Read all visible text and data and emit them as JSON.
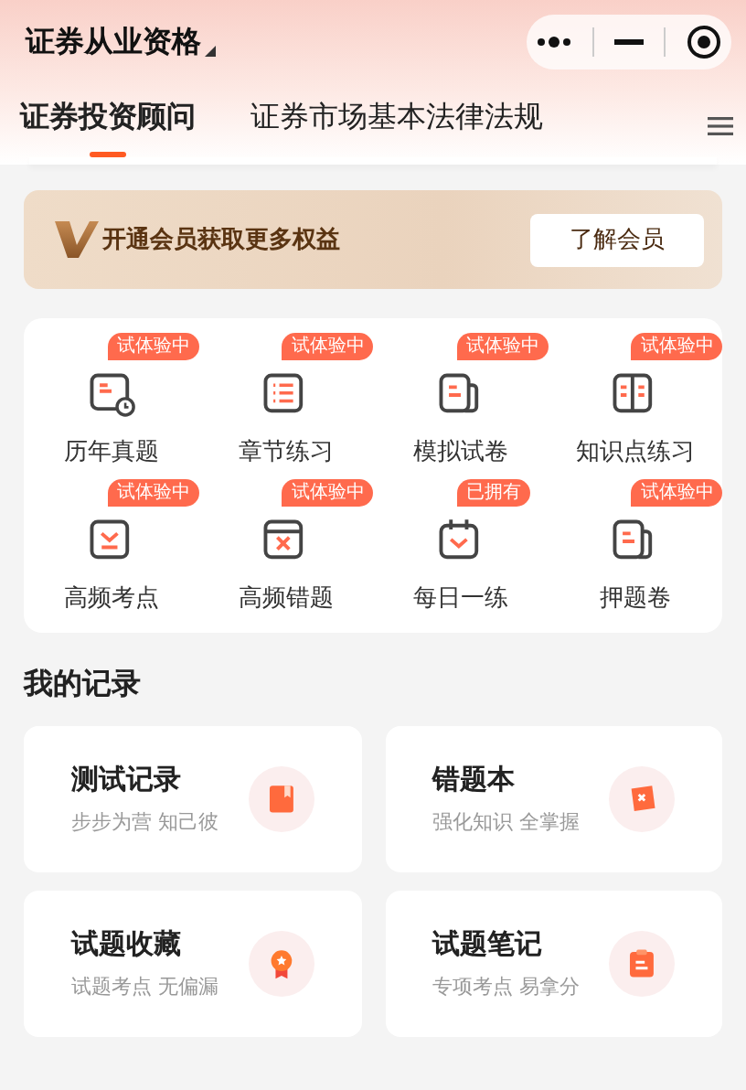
{
  "header": {
    "title": "证券从业资格"
  },
  "tabs": [
    {
      "label": "证券投资顾问",
      "selected": true
    },
    {
      "label": "证券市场基本法律法规",
      "selected": false
    }
  ],
  "banner": {
    "text": "开通会员获取更多权益",
    "button": "了解会员"
  },
  "features": [
    {
      "label": "历年真题",
      "badge": "试体验中",
      "kind": "history"
    },
    {
      "label": "章节练习",
      "badge": "试体验中",
      "kind": "list"
    },
    {
      "label": "模拟试卷",
      "badge": "试体验中",
      "kind": "paper"
    },
    {
      "label": "知识点练习",
      "badge": "试体验中",
      "kind": "book"
    },
    {
      "label": "高频考点",
      "badge": "试体验中",
      "kind": "point"
    },
    {
      "label": "高频错题",
      "badge": "试体验中",
      "kind": "wrong"
    },
    {
      "label": "每日一练",
      "badge": "已拥有",
      "kind": "calendar"
    },
    {
      "label": "押题卷",
      "badge": "试体验中",
      "kind": "paper"
    }
  ],
  "records": {
    "title": "我的记录",
    "cards": [
      {
        "title": "测试记录",
        "subtitle": "步步为营 知己彼",
        "kind": "test"
      },
      {
        "title": "错题本",
        "subtitle": "强化知识 全掌握",
        "kind": "wrong"
      },
      {
        "title": "试题收藏",
        "subtitle": "试题考点 无偏漏",
        "kind": "favorite"
      },
      {
        "title": "试题笔记",
        "subtitle": "专项考点 易拿分",
        "kind": "note"
      }
    ]
  }
}
